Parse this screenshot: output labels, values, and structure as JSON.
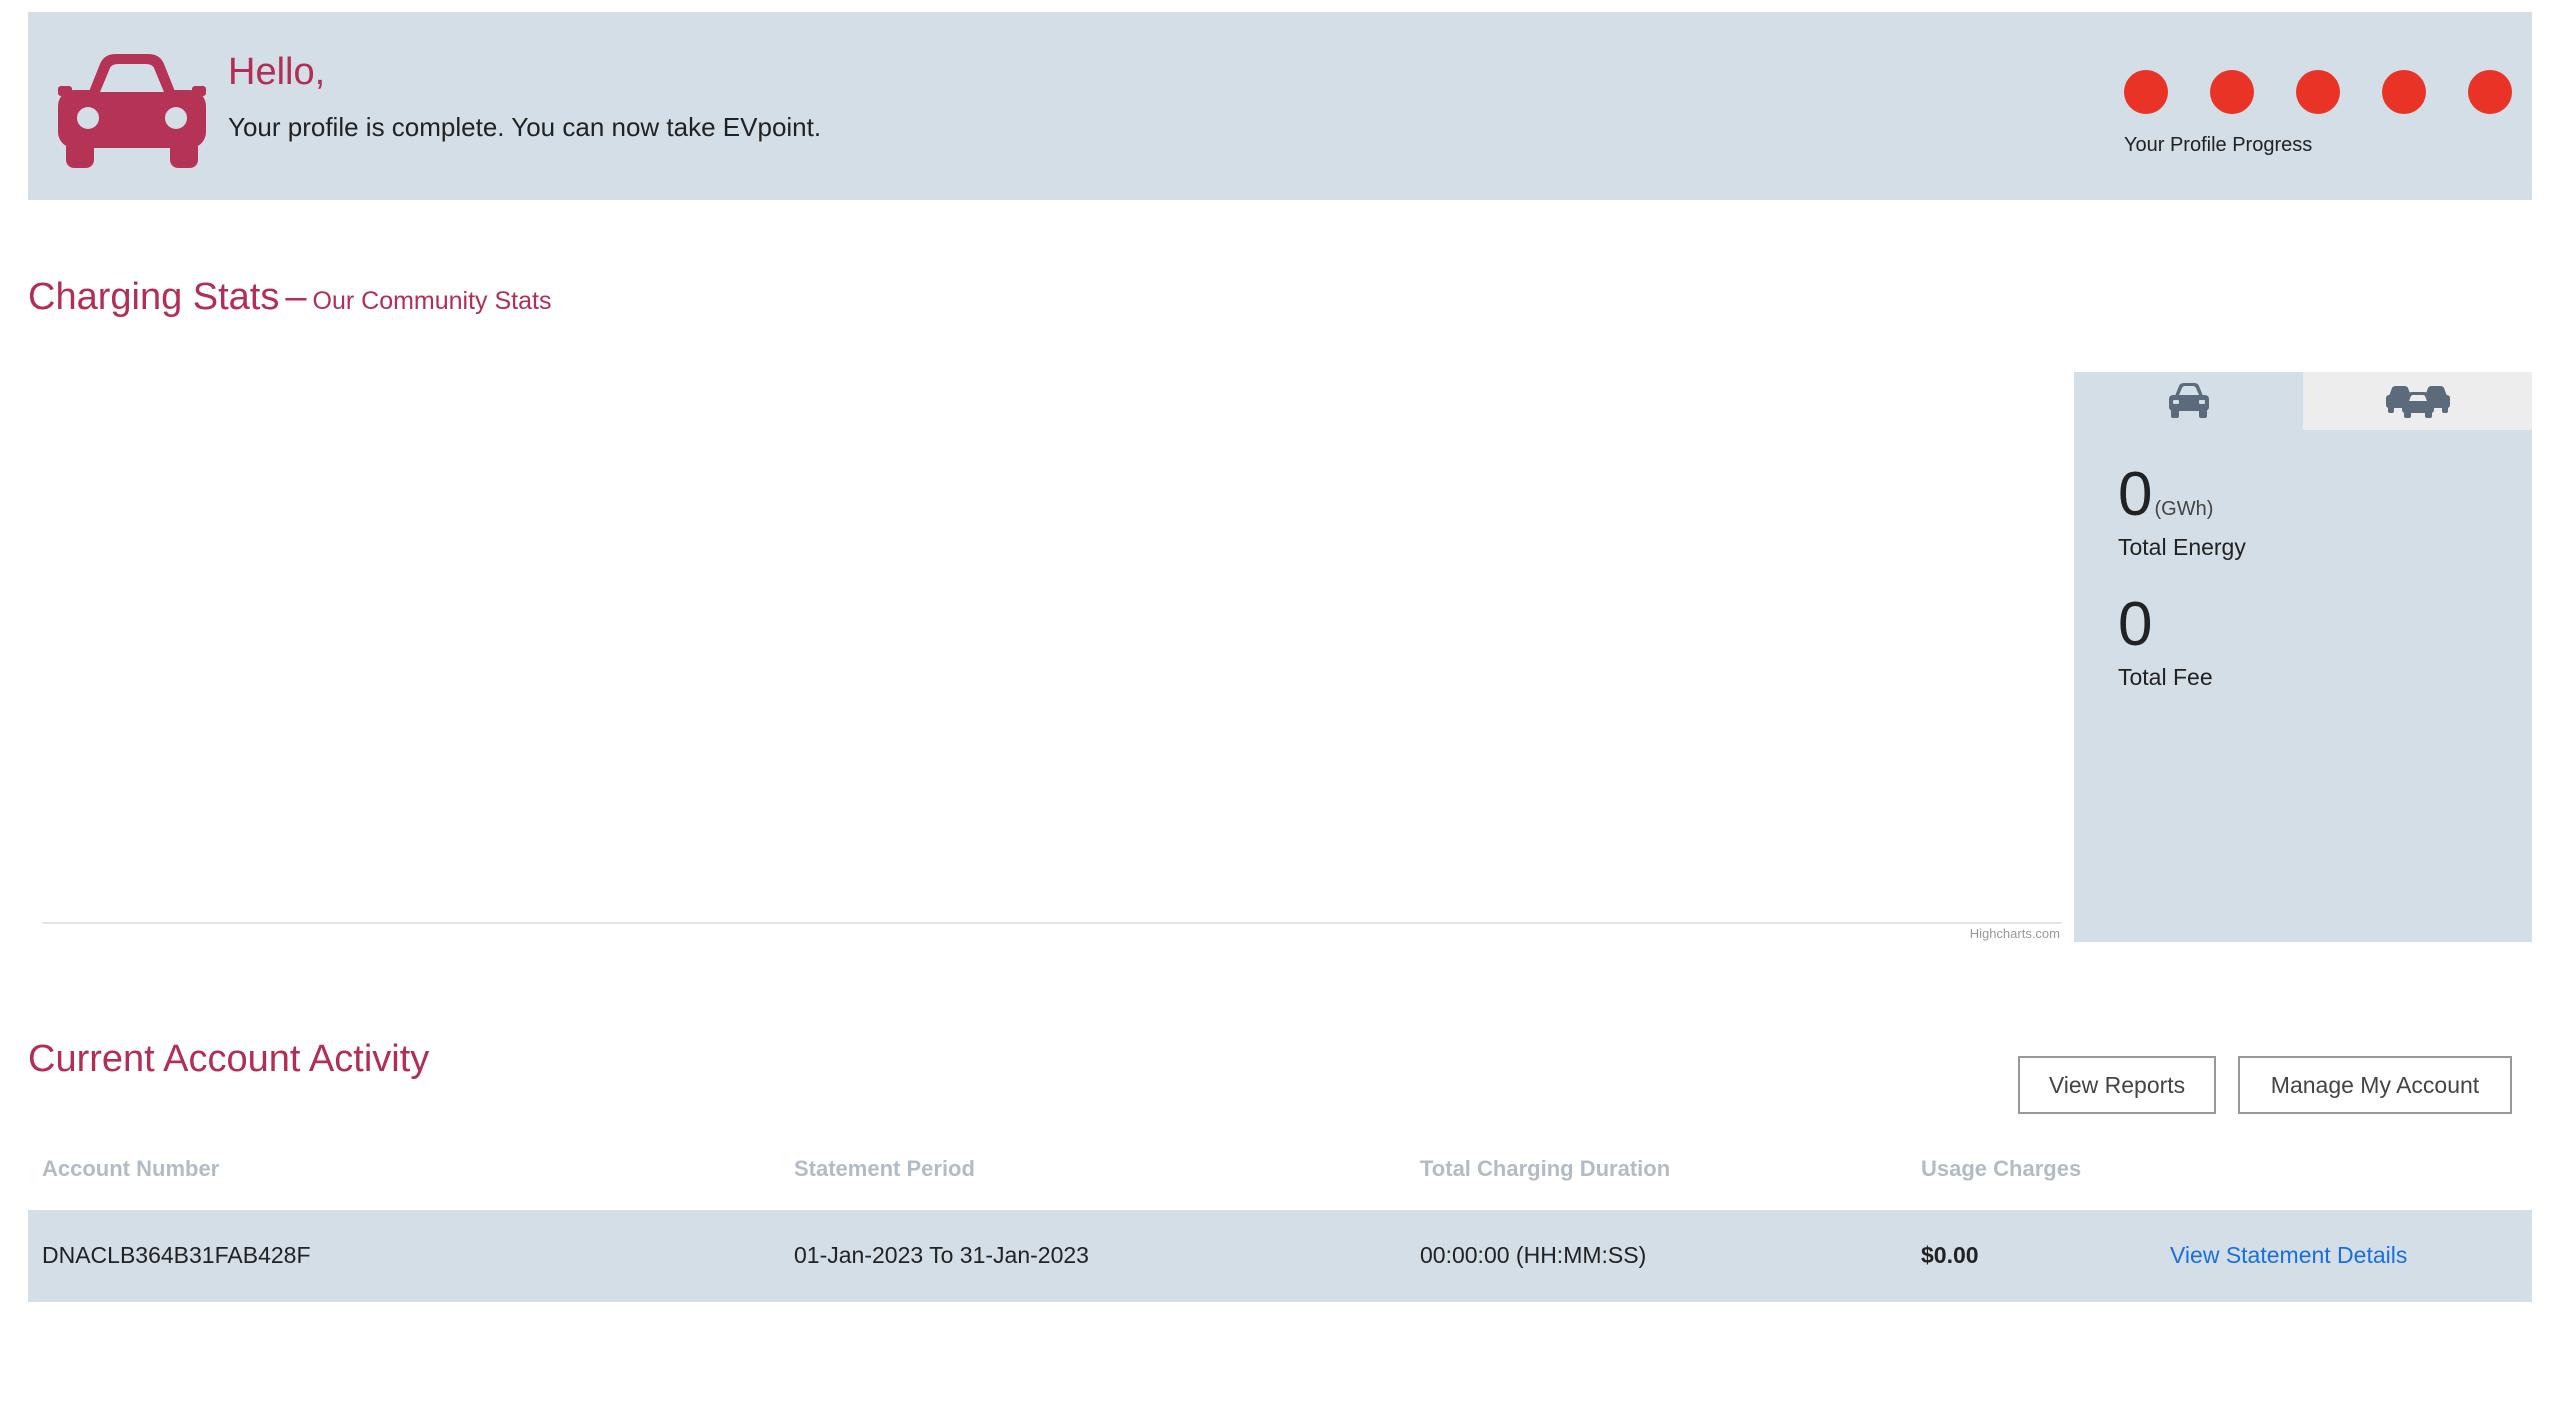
{
  "banner": {
    "greeting": "Hello,",
    "message": "Your profile is complete. You can now take EVpoint.",
    "progress": {
      "steps_total": 5,
      "steps_complete": 5,
      "label": "Your Profile Progress",
      "dot_color": "#ea3327"
    }
  },
  "charging_stats": {
    "title": "Charging Stats",
    "dash": "–",
    "subtitle": "Our Community Stats",
    "chart_credits": "Highcharts.com",
    "tabs": [
      {
        "icon": "car-icon"
      },
      {
        "icon": "cars-icon"
      }
    ],
    "total_energy": {
      "value": "0",
      "unit": "(GWh)",
      "label": "Total Energy"
    },
    "total_fee": {
      "value": "0",
      "label": "Total Fee"
    }
  },
  "account_activity": {
    "title": "Current Account Activity",
    "view_reports_label": "View Reports",
    "manage_account_label": "Manage My Account",
    "columns": [
      "Account Number",
      "Statement Period",
      "Total Charging Duration",
      "Usage Charges"
    ],
    "rows": [
      {
        "account_number": "DNACLB364B31FAB428F",
        "statement_period": "01-Jan-2023 To 31-Jan-2023",
        "duration": "00:00:00 (HH:MM:SS)",
        "usage_charges": "$0.00",
        "details_link": "View Statement Details"
      }
    ]
  },
  "colors": {
    "accent": "#b22e55",
    "panel_bg": "#d3dee7",
    "link": "#1a6fe0",
    "progress_dot": "#ea3327"
  }
}
